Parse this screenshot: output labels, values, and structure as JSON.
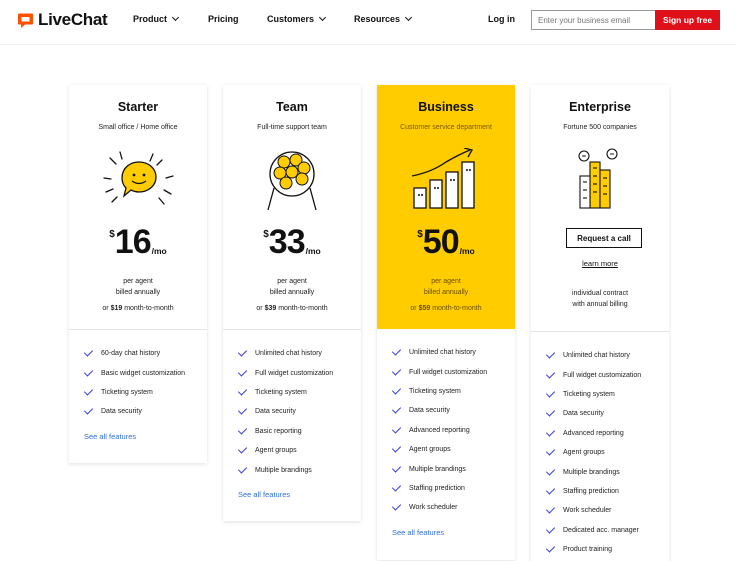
{
  "nav": {
    "logo_text": "LiveChat",
    "items": [
      {
        "label": "Product",
        "dropdown": true
      },
      {
        "label": "Pricing",
        "dropdown": false
      },
      {
        "label": "Customers",
        "dropdown": true
      },
      {
        "label": "Resources",
        "dropdown": true
      }
    ],
    "login": "Log in",
    "email_placeholder": "Enter your business email",
    "signup": "Sign up free"
  },
  "colors": {
    "brand_red": "#e0101b",
    "highlight_yellow": "#ffcc00",
    "check_blue": "#3b3fd6",
    "link_blue": "#2f6fd8"
  },
  "plans": [
    {
      "name": "Starter",
      "subtitle": "Small office / Home office",
      "illustration": "speech-bubble-icon",
      "currency": "$",
      "price": "16",
      "period": "/mo",
      "billing_1": "per agent",
      "billing_2": "billed annually",
      "monthly_prefix": "or ",
      "monthly_price": "$19",
      "monthly_suffix": " month-to-month",
      "features": [
        "60-day chat history",
        "Basic widget customization",
        "Ticketing system",
        "Data security"
      ],
      "see_all": "See all features"
    },
    {
      "name": "Team",
      "subtitle": "Full-time support team",
      "illustration": "team-group-icon",
      "currency": "$",
      "price": "33",
      "period": "/mo",
      "billing_1": "per agent",
      "billing_2": "billed annually",
      "monthly_prefix": "or ",
      "monthly_price": "$39",
      "monthly_suffix": " month-to-month",
      "features": [
        "Unlimited chat history",
        "Full widget customization",
        "Ticketing system",
        "Data security",
        "Basic reporting",
        "Agent groups",
        "Multiple brandings"
      ],
      "see_all": "See all features"
    },
    {
      "name": "Business",
      "subtitle": "Customer service department",
      "illustration": "growth-chart-icon",
      "currency": "$",
      "price": "50",
      "period": "/mo",
      "billing_1": "per agent",
      "billing_2": "billed annually",
      "monthly_prefix": "or ",
      "monthly_price": "$59",
      "monthly_suffix": " month-to-month",
      "features": [
        "Unlimited chat history",
        "Full widget customization",
        "Ticketing system",
        "Data security",
        "Advanced reporting",
        "Agent groups",
        "Multiple brandings",
        "Staffing prediction",
        "Work scheduler"
      ],
      "see_all": "See all features"
    },
    {
      "name": "Enterprise",
      "subtitle": "Fortune 500 companies",
      "illustration": "skyscraper-icon",
      "cta": "Request a call",
      "learn_more": "learn more",
      "note_1": "individual contract",
      "note_2": "with annual billing",
      "features": [
        "Unlimited chat history",
        "Full widget customization",
        "Ticketing system",
        "Data security",
        "Advanced reporting",
        "Agent groups",
        "Multiple brandings",
        "Staffing prediction",
        "Work scheduler",
        "Dedicated acc. manager",
        "Product training"
      ]
    }
  ]
}
